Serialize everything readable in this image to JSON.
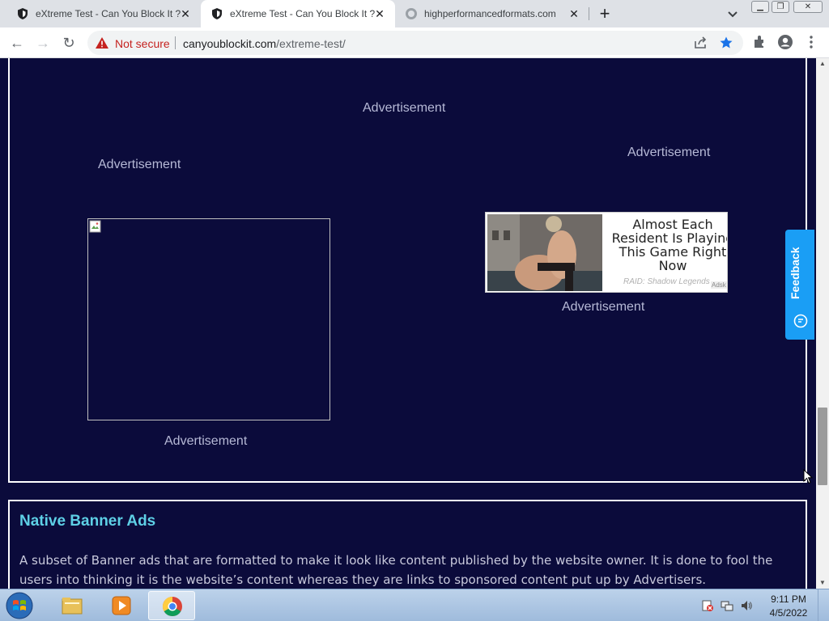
{
  "browser": {
    "tabs": [
      {
        "title": "eXtreme Test - Can You Block It ?",
        "active": false,
        "favicon": "shield-icon"
      },
      {
        "title": "eXtreme Test - Can You Block It ?",
        "active": true,
        "favicon": "shield-icon"
      },
      {
        "title": "highperformancedformats.com",
        "active": false,
        "favicon": "globe-icon"
      }
    ],
    "security_label": "Not secure",
    "url_host": "canyoublockit.com",
    "url_path": "/extreme-test/"
  },
  "page": {
    "ad_labels": [
      "Advertisement",
      "Advertisement",
      "Advertisement",
      "Advertisement",
      "Advertisement"
    ],
    "native_ad": {
      "headline": "Almost Each Resident Is Playing This Game Right Now",
      "source": "RAID: Shadow Legends",
      "badge": "Adsk"
    },
    "native_section": {
      "title": "Native Banner Ads",
      "text": "A subset of Banner ads that are formatted to make it look like content published by the website owner. It is done to fool the users into thinking it is the website’s content whereas they are links to sponsored content put up by Advertisers."
    },
    "feedback_label": "Feedback"
  },
  "taskbar": {
    "time": "9:11 PM",
    "date": "4/5/2022"
  }
}
